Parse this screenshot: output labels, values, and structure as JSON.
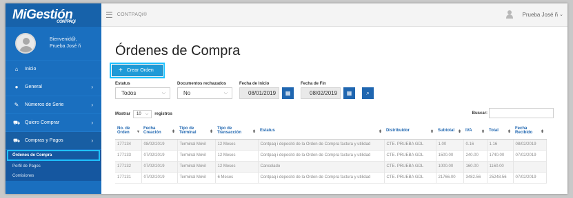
{
  "app": {
    "logo_text": "MiGestión",
    "logo_sub": "CONTPAQi",
    "brand": "CONTPAQi®"
  },
  "user": {
    "greeting": "Bienvenid@,",
    "name_sidebar": "Prueba José ñ",
    "name_top": "Prueba José ñ"
  },
  "sidebar": {
    "items": [
      {
        "label": "Inicio",
        "icon": "home-icon",
        "glyph": "⌂",
        "chevron": ""
      },
      {
        "label": "General",
        "icon": "user-icon",
        "glyph": "●",
        "chevron": "›"
      },
      {
        "label": "Números de Serie",
        "icon": "edit-icon",
        "glyph": "✎",
        "chevron": "›"
      },
      {
        "label": "Quiero Comprar",
        "icon": "cart-icon",
        "glyph": "⛟",
        "chevron": "›"
      },
      {
        "label": "Compras y Pagos",
        "icon": "cart-icon",
        "glyph": "⛟",
        "chevron": "›"
      }
    ],
    "subitems": [
      {
        "label": "Órdenes de Compra"
      },
      {
        "label": "Perfil de Pagos"
      },
      {
        "label": "Comisiones"
      }
    ]
  },
  "page": {
    "title": "Órdenes de Compra",
    "create_button": "Crear Orden",
    "create_icon": "+"
  },
  "filters": {
    "estatus_label": "Estatus",
    "estatus_value": "Todos",
    "rechazados_label": "Documentos rechazados",
    "rechazados_value": "No",
    "inicio_label": "Fecha de Inicio",
    "inicio_value": "08/01/2019",
    "fin_label": "Fecha de Fin",
    "fin_value": "08/02/2019"
  },
  "table_controls": {
    "mostrar": "Mostrar",
    "length": "10",
    "registros": "registros",
    "buscar": "Buscar:"
  },
  "table": {
    "columns": [
      {
        "line1": "No. de",
        "line2": "Orden",
        "sort": "▾"
      },
      {
        "line1": "Fecha",
        "line2": "Creación",
        "sort": "⬍"
      },
      {
        "line1": "Tipo de",
        "line2": "Terminal",
        "sort": "⬍"
      },
      {
        "line1": "Tipo de",
        "line2": "Transacción",
        "sort": "⬍"
      },
      {
        "line1": "Estatus",
        "line2": "",
        "sort": "⬍"
      },
      {
        "line1": "Distribuidor",
        "line2": "",
        "sort": "⬍"
      },
      {
        "line1": "Subtotal",
        "line2": "",
        "sort": "⬍"
      },
      {
        "line1": "IVA",
        "line2": "",
        "sort": "⬍"
      },
      {
        "line1": "Total",
        "line2": "",
        "sort": "⬍"
      },
      {
        "line1": "Fecha",
        "line2": "Recibido",
        "sort": "⬍"
      }
    ],
    "rows": [
      [
        "177134",
        "08/02/2019",
        "Terminal Móvil",
        "12 Meses",
        "Contpaq i depositó de la Orden de Compra factura y utilidad",
        "CTE. PRUEBA GDL",
        "1.00",
        "0.16",
        "1.16",
        "08/02/2019"
      ],
      [
        "177133",
        "07/02/2019",
        "Terminal Móvil",
        "12 Meses",
        "Contpaq i depositó de la Orden de Compra factura y utilidad",
        "CTE. PRUEBA GDL",
        "1500.00",
        "240.00",
        "1740.00",
        "07/02/2019"
      ],
      [
        "177132",
        "07/02/2019",
        "Terminal Móvil",
        "12 Meses",
        "Cancelado",
        "CTE. PRUEBA GDL",
        "1000.00",
        "160.00",
        "1160.00",
        ""
      ],
      [
        "177131",
        "07/02/2019",
        "Terminal Móvil",
        "6 Meses",
        "Contpaq i depositó de la Orden de Compra factura y utilidad",
        "CTE. PRUEBA GDL",
        "21766.00",
        "3482.56",
        "25248.56",
        "07/02/2019"
      ]
    ]
  },
  "colors": {
    "sidebar": "#1a6fbf",
    "accent": "#1f9ad7",
    "highlight": "#1ec1ff",
    "header_text": "#1f66b0"
  }
}
